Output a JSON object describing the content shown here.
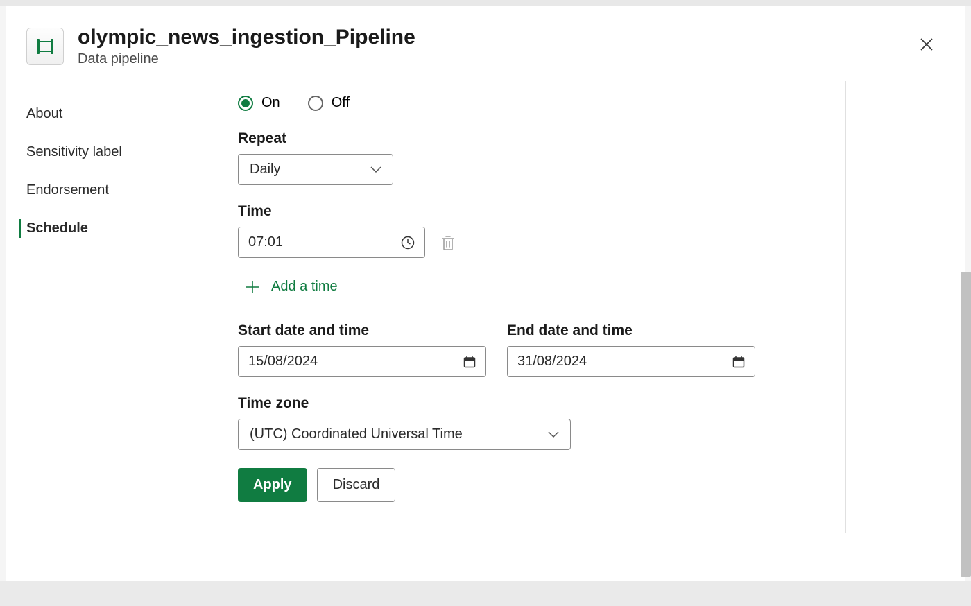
{
  "header": {
    "title": "olympic_news_ingestion_Pipeline",
    "subtitle": "Data pipeline"
  },
  "sidebar": {
    "items": [
      {
        "label": "About"
      },
      {
        "label": "Sensitivity label"
      },
      {
        "label": "Endorsement"
      },
      {
        "label": "Schedule"
      }
    ]
  },
  "schedule": {
    "toggle": {
      "on_label": "On",
      "off_label": "Off",
      "value": "On"
    },
    "repeat": {
      "label": "Repeat",
      "value": "Daily"
    },
    "time": {
      "label": "Time",
      "value": "07:01"
    },
    "add_time_label": "Add a time",
    "start": {
      "label": "Start date and time",
      "value": "15/08/2024"
    },
    "end": {
      "label": "End date and time",
      "value": "31/08/2024"
    },
    "timezone": {
      "label": "Time zone",
      "value": "(UTC) Coordinated Universal Time"
    },
    "apply_label": "Apply",
    "discard_label": "Discard"
  }
}
